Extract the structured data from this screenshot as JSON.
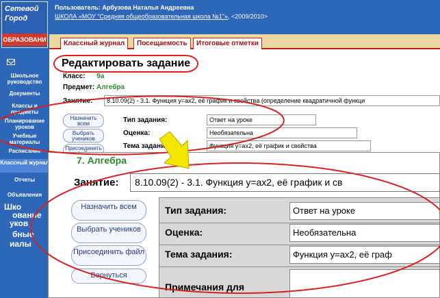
{
  "sidebar": {
    "logo": {
      "line1": "Сетевой",
      "line2": "Город",
      "line3": "ОБРАЗОВАНИ"
    },
    "items": [
      {
        "label": "Школьное руководство"
      },
      {
        "label": "Документы"
      },
      {
        "label": "Классы и предметы"
      },
      {
        "label": "Планирование уроков"
      },
      {
        "label": "Учебные материалы"
      },
      {
        "label": "Расписание"
      },
      {
        "label": "Классный журнал"
      },
      {
        "label": "Отчеты"
      },
      {
        "label": "Объявления"
      }
    ],
    "zoom_items": [
      "Шко",
      "ование",
      "уков",
      "бные",
      "иалы"
    ]
  },
  "header": {
    "user_line": "Пользователь: Арбузова Наталья Андреевна",
    "school_link": "ШКОЛА «МОУ \"Средняя общеобразовательная школа №1\"»",
    "year": ", <2009/2010>"
  },
  "tabs": [
    {
      "label": "Классный журнал"
    },
    {
      "label": "Посещаемость"
    },
    {
      "label": "Итоговые отметки"
    }
  ],
  "page": {
    "title": "Редактировать задание",
    "class_label": "Класс:",
    "class_value": "9а",
    "subject_label": "Предмет:",
    "subject_value": "Алгебра",
    "lesson_label": "Занятие:",
    "lesson_value": "8.10.09(2) - 3.1. Функция y=ax2, её график и свойства (определение квадратичной функци"
  },
  "buttons": [
    {
      "label": "Назначить всем"
    },
    {
      "label": "Выбрать учеников"
    },
    {
      "label": "Присоединить файл"
    },
    {
      "label": "Вернуться"
    }
  ],
  "form": {
    "type_label": "Тип задания:",
    "type_value": "Ответ на уроке",
    "grade_label": "Оценка:",
    "grade_value": "Необязательна",
    "topic_label": "Тема задания:",
    "topic_value": "Функция y=ax2, её график и свойства",
    "notes_label": "Примечания для"
  },
  "zoom": {
    "subject_title": "7. Алгебра",
    "lesson_value": "8.10.09(2) - 3.1. Функция y=ax2, её график и св",
    "topic_value": "Функция y=ax2, её граф"
  },
  "colors": {
    "brand_blue": "#2e66b8",
    "tab_red": "#c02020",
    "annotation_red": "#d22222",
    "arrow_yellow": "#f2e600",
    "subject_green": "#2d8a2d"
  }
}
